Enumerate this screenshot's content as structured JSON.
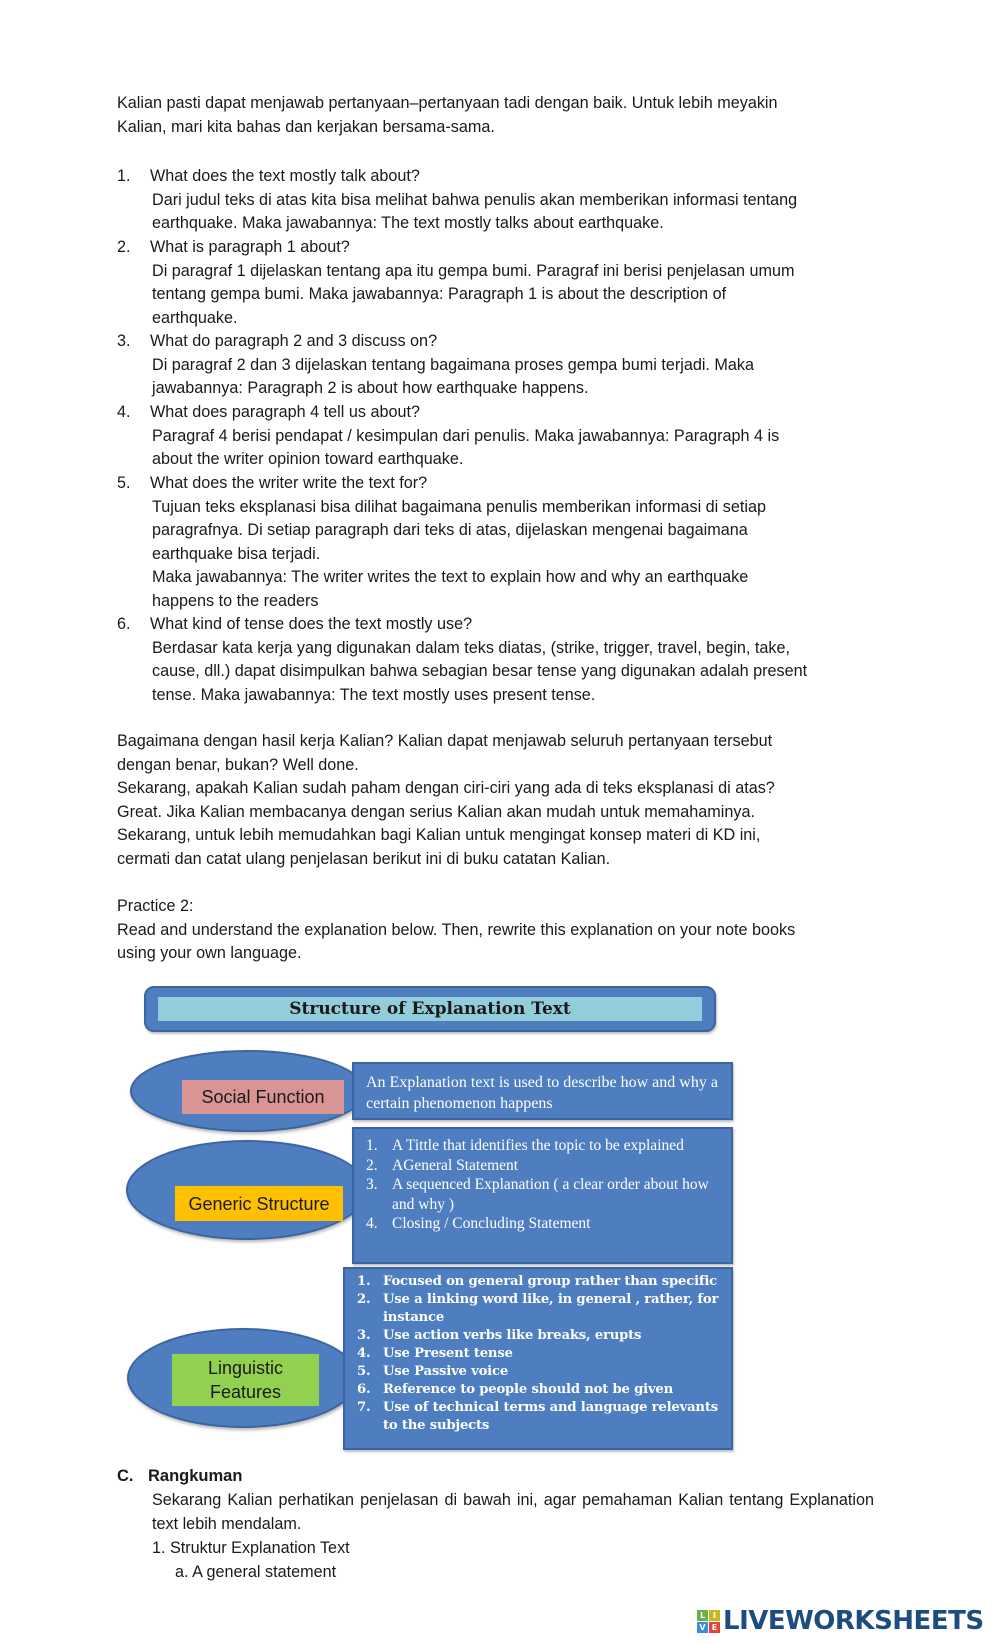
{
  "intro": {
    "lines": [
      "Kalian pasti dapat menjawab pertanyaan–pertanyaan tadi dengan baik. Untuk lebih meyakin",
      "Kalian, mari kita bahas dan kerjakan bersama-sama."
    ]
  },
  "questions": [
    {
      "number": "1.",
      "question": "What does the text mostly talk about?",
      "answer": [
        "Dari judul teks di atas kita bisa melihat bahwa penulis akan memberikan informasi tentang",
        "earthquake. Maka jawabannya: The text mostly talks about earthquake."
      ]
    },
    {
      "number": "2.",
      "question": "What is paragraph 1 about?",
      "answer": [
        "Di paragraf 1 dijelaskan tentang apa itu gempa bumi. Paragraf ini berisi penjelasan umum",
        "tentang gempa bumi. Maka jawabannya: Paragraph 1 is about the description of",
        "earthquake."
      ]
    },
    {
      "number": "3.",
      "question": "What do paragraph 2 and 3 discuss on?",
      "answer": [
        "Di paragraf 2 dan 3 dijelaskan tentang bagaimana proses gempa bumi terjadi. Maka",
        "jawabannya: Paragraph 2 is about how earthquake happens."
      ]
    },
    {
      "number": "4.",
      "question": "What does paragraph 4 tell us about?",
      "answer": [
        "Paragraf 4 berisi pendapat / kesimpulan dari penulis. Maka jawabannya: Paragraph 4 is",
        "about the writer opinion toward earthquake."
      ]
    },
    {
      "number": "5.",
      "question": "What does the writer write the text for?",
      "answer": [
        "Tujuan teks eksplanasi bisa dilihat bagaimana penulis memberikan informasi di setiap",
        "paragrafnya. Di setiap paragraph dari teks di atas, dijelaskan mengenai bagaimana",
        "earthquake bisa terjadi.",
        "Maka jawabannya: The writer writes the text to explain how and why an earthquake",
        "happens to the readers"
      ]
    },
    {
      "number": "6.",
      "question": "What kind of tense does the text mostly use?",
      "answer": [
        "Berdasar kata kerja yang digunakan dalam teks diatas, (strike, trigger, travel, begin, take,",
        "cause, dll.) dapat disimpulkan bahwa sebagian besar tense yang digunakan adalah present",
        "tense. Maka jawabannya: The text mostly uses present tense."
      ]
    }
  ],
  "closing": {
    "lines": [
      "Bagaimana dengan hasil kerja Kalian? Kalian dapat menjawab seluruh pertanyaan tersebut",
      "dengan benar, bukan? Well done.",
      "Sekarang, apakah Kalian sudah paham dengan ciri-ciri yang ada di teks eksplanasi di atas?",
      "Great. Jika Kalian membacanya dengan serius Kalian akan mudah untuk memahaminya.",
      "Sekarang, untuk lebih memudahkan bagi Kalian untuk mengingat konsep materi di KD ini,",
      "cermati dan catat ulang penjelasan berikut ini di buku catatan Kalian."
    ]
  },
  "practice": {
    "title": "Practice 2:",
    "lines": [
      "Read and understand the explanation below. Then, rewrite this explanation on your note books",
      "using your own language."
    ]
  },
  "diagram": {
    "title": "Structure of Explanation Text",
    "colors": {
      "blue": "#4f7ec0",
      "title_fill": "#92cddc",
      "social_label": "#d99594",
      "generic_label": "#ffc000",
      "linguistic_label": "#92d050"
    },
    "social_function": {
      "label": "Social Function",
      "text": "An Explanation text is used to describe how and why  a certain phenomenon happens"
    },
    "generic_structure": {
      "label": "Generic Structure",
      "items": [
        {
          "n": "1.",
          "text": "A Tittle that identifies the topic to be explained"
        },
        {
          "n": "2.",
          "text": "AGeneral Statement"
        },
        {
          "n": "3.",
          "text": "A sequenced Explanation ( a clear order about how and why )"
        },
        {
          "n": "4.",
          "text": "Closing / Concluding Statement"
        }
      ]
    },
    "linguistic_features": {
      "label_line1": "Linguistic",
      "label_line2": "Features",
      "items": [
        {
          "n": "1.",
          "text": "Focused on general group rather than specific"
        },
        {
          "n": "2.",
          "text": "Use a linking word like, in general , rather, for instance"
        },
        {
          "n": "3.",
          "text": "Use action verbs like  breaks, erupts"
        },
        {
          "n": "4.",
          "text": "Use Present tense"
        },
        {
          "n": "5.",
          "text": "Use Passive voice"
        },
        {
          "n": "6.",
          "text": "Reference to people should not be given"
        },
        {
          "n": "7.",
          "text": "Use of technical terms and language relevants to the subjects"
        }
      ]
    }
  },
  "summary": {
    "letter": "C.",
    "heading": "Rangkuman",
    "intro": "Sekarang Kalian perhatikan penjelasan di bawah ini, agar pemahaman Kalian tentang Explanation text lebih mendalam.",
    "item1": "1. Struktur Explanation Text",
    "item1a": "a. A general statement"
  },
  "logo": {
    "tiles": [
      {
        "letter": "L",
        "color": "#6ab04c"
      },
      {
        "letter": "I",
        "color": "#c8b820"
      },
      {
        "letter": "V",
        "color": "#3a8fd6"
      },
      {
        "letter": "E",
        "color": "#e0463a"
      }
    ],
    "wordmark": "LIVEWORKSHEETS",
    "color": "#1d4c80"
  }
}
